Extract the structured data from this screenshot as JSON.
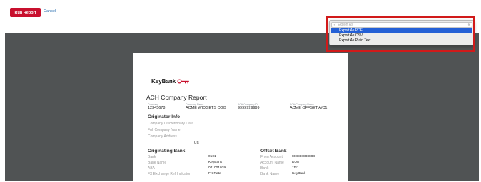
{
  "toolbar": {
    "run_label": "Run Report",
    "cancel_label": "Cancel"
  },
  "export": {
    "placeholder": "Export As",
    "options": [
      "Export As PDF",
      "Export As CSV",
      "Export As Plain Text"
    ],
    "highlighted_index": 0
  },
  "report": {
    "logo_text": "KeyBank",
    "title": "ACH Company Report",
    "header_fields": [
      {
        "label": "Company",
        "value": "12345678"
      },
      {
        "label": "Company Name",
        "value": "ACME WIDGETS OGB"
      },
      {
        "label": "ACH Company ID",
        "value": "9999999999"
      },
      {
        "label": "ACH Company Name",
        "value": "ACME OFFSET A/C1"
      }
    ],
    "originator": {
      "title": "Originator Info",
      "rows": [
        {
          "label": "Company Discretionary Data",
          "value": ""
        },
        {
          "label": "Full Company Name",
          "value": ""
        },
        {
          "label": "Company Address",
          "value": ""
        }
      ],
      "country": "US"
    },
    "originating_bank": {
      "title": "Originating Bank",
      "rows": [
        {
          "label": "Bank",
          "value": "0101"
        },
        {
          "label": "Bank Name",
          "value": "KeyBank"
        },
        {
          "label": "ABA",
          "value": "041001039"
        },
        {
          "label": "FX Exchange Ref Indicator",
          "value": "FX Rate"
        }
      ]
    },
    "offset_bank": {
      "title": "Offset Bank",
      "rows": [
        {
          "label": "From Account",
          "value": "888888888888"
        },
        {
          "label": "Account Name",
          "value": "DDA"
        },
        {
          "label": "Bank",
          "value": "1111"
        },
        {
          "label": "Bank Name",
          "value": "KeyBank"
        }
      ]
    }
  },
  "colors": {
    "brand_red": "#c8102e",
    "viewer_bg": "#505354",
    "highlight": "#d11a1a",
    "selected_option": "#2460d6"
  }
}
